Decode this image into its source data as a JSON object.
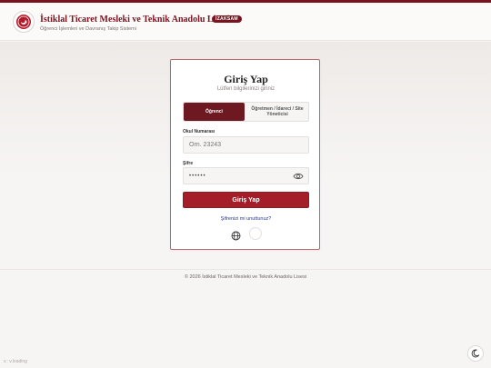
{
  "header": {
    "school_name": "İstiklal Ticaret Mesleki ve Teknik Anadolu Lisesi",
    "badge": "İZAKSAM",
    "subtitle": "Öğrenci İşlemleri ve Davranış Takip Sistemi"
  },
  "login": {
    "title": "Giriş Yap",
    "subtitle": "Lütfen bilgilerinizi giriniz",
    "tabs": [
      {
        "label": "Öğrenci",
        "active": true
      },
      {
        "label": "Öğretmen / İdareci / Site Yöneticisi",
        "active": false
      }
    ],
    "school_number_label": "Okul Numarası",
    "school_number_placeholder": "Örn. 23243",
    "password_label": "Şifre",
    "password_value": "••••••",
    "submit_label": "Giriş Yap",
    "forgot_label": "Şifrenizi mi unuttunuz?"
  },
  "footer": {
    "copyright": "© 2026 İstiklal Ticaret Mesleki ve Teknik Anadolu Lisesi"
  },
  "corner_text": "v.: v.loading",
  "colors": {
    "brand": "#7a1320",
    "button": "#a51d28",
    "link": "#2a3a8a"
  },
  "icons": {
    "logo": "school-crest-icon",
    "show_password": "eye-icon",
    "language": "globe-icon",
    "theme": "moon-icon"
  }
}
